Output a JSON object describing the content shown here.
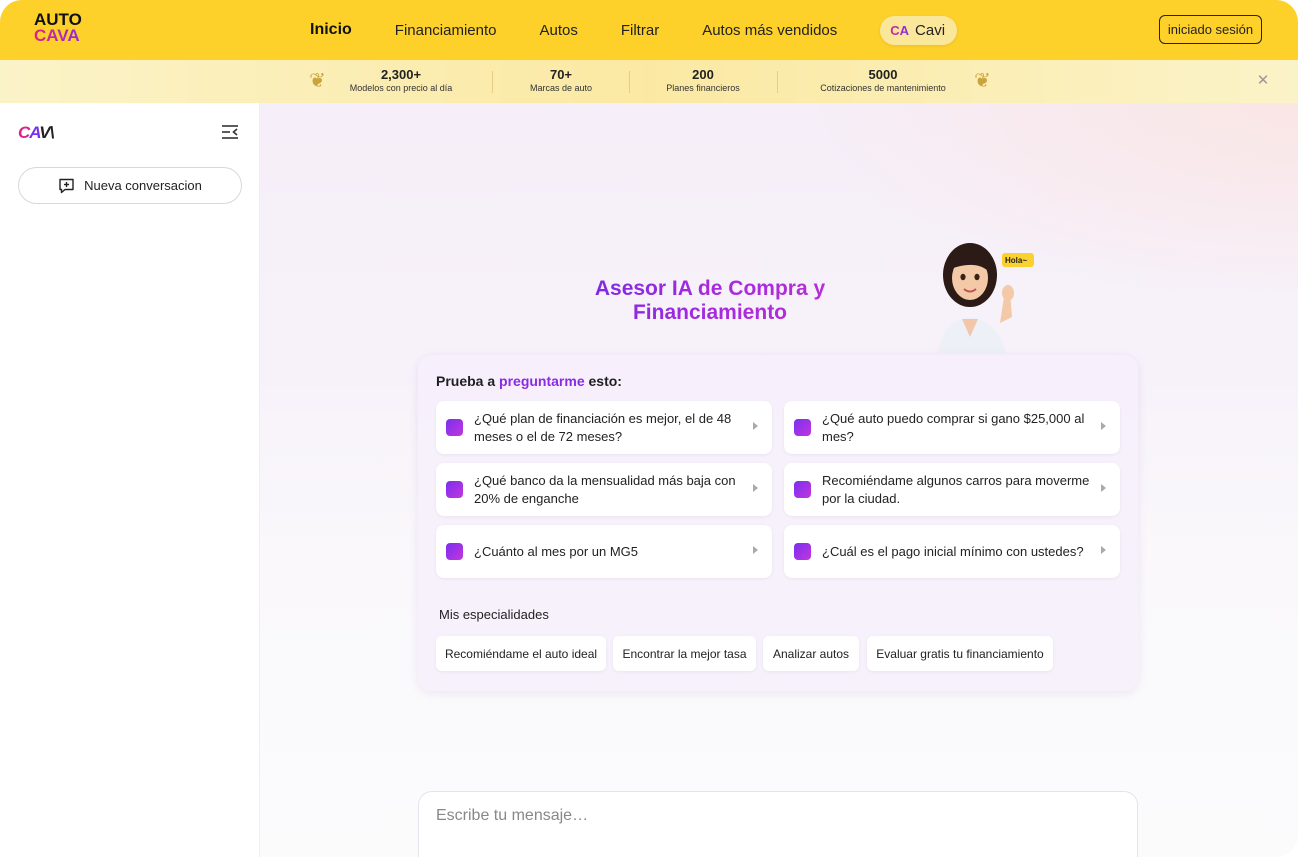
{
  "brand": {
    "logo_line1": "AUTO",
    "logo_line2": "CAVA"
  },
  "nav": {
    "items": [
      "Inicio",
      "Financiamiento",
      "Autos",
      "Filtrar",
      "Autos más vendidos"
    ],
    "cavi_badge": "CA",
    "cavi_label": "Cavi",
    "login_label": "iniciado sesión"
  },
  "stats": [
    {
      "value": "2,300+",
      "label": "Modelos con precio al día"
    },
    {
      "value": "70+",
      "label": "Marcas de auto"
    },
    {
      "value": "200",
      "label": "Planes financieros"
    },
    {
      "value": "5000",
      "label": "Cotizaciones de mantenimiento"
    }
  ],
  "sidebar": {
    "logo": {
      "c": "C",
      "a": "A",
      "v": "V\\"
    },
    "new_chat_label": "Nueva conversacion"
  },
  "hero": {
    "title": "Asesor IA de Compra y Financiamiento",
    "avatar_bubble": "Hola~"
  },
  "prompts": {
    "title_prefix": "Prueba a",
    "title_highlight": "preguntarme",
    "title_suffix": "esto:",
    "questions": [
      "¿Qué plan de financiación es mejor, el de 48 meses o el de 72 meses?",
      "¿Qué auto puedo comprar si gano $25,000 al mes?",
      "¿Qué banco da la mensualidad más baja con 20% de enganche",
      "Recomiéndame algunos carros para moverme por la ciudad.",
      "¿Cuánto al mes por un MG5",
      "¿Cuál es el pago inicial mínimo con ustedes?"
    ]
  },
  "specialties": {
    "title": "Mis especialidades",
    "chips": [
      "Recomiéndame el auto ideal",
      "Encontrar la mejor tasa",
      "Analizar autos",
      "Evaluar gratis tu financiamiento"
    ]
  },
  "composer": {
    "placeholder": "Escribe tu mensaje…"
  },
  "colors": {
    "topbar": "#fdd02a",
    "accent_purple": "#8a2be2",
    "accent_pink": "#e0218a"
  }
}
